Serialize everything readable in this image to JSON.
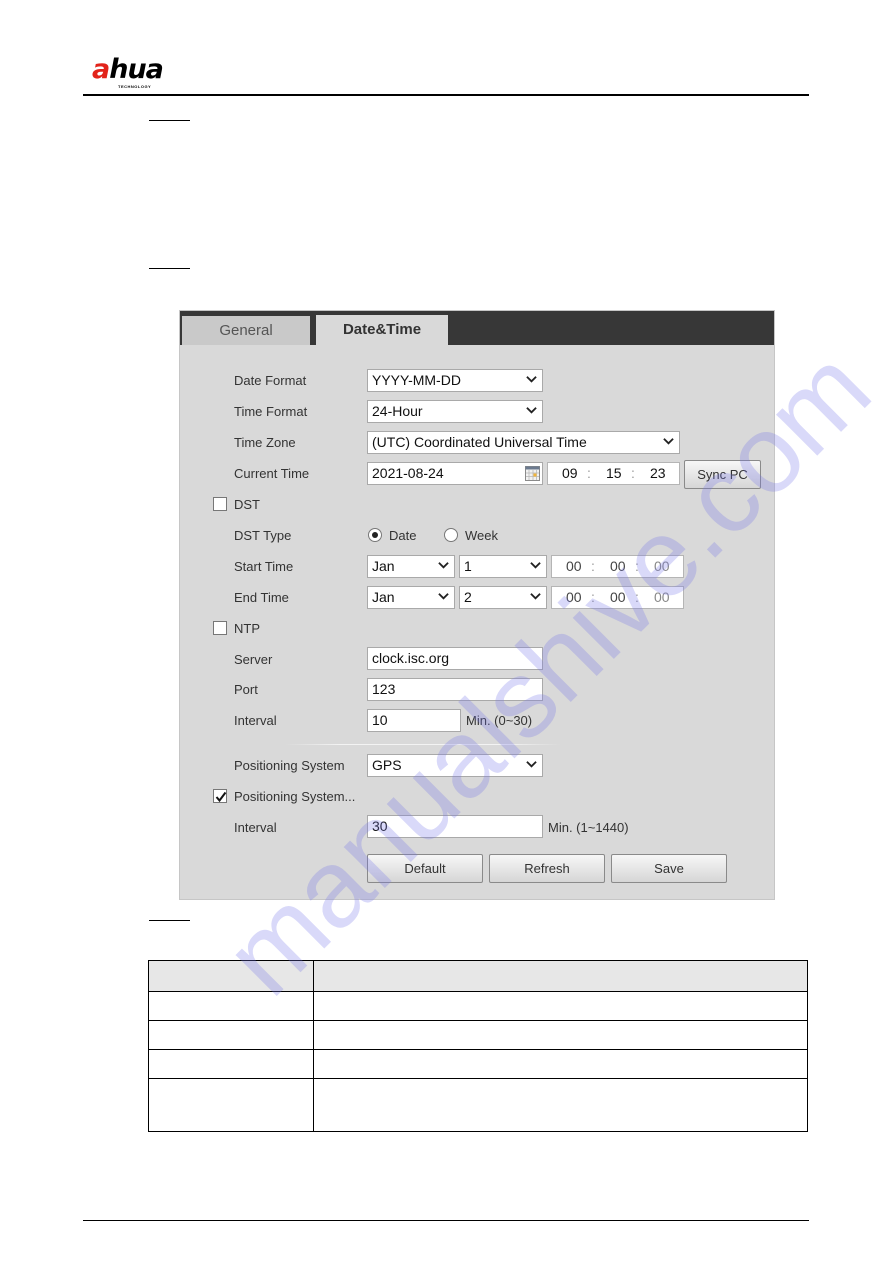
{
  "brand": {
    "name_prefix": "a",
    "name_rest": "hua",
    "tagline": "TECHNOLOGY",
    "accent_color": "#e2231a"
  },
  "panel": {
    "tabs": [
      {
        "label": "General",
        "active": false
      },
      {
        "label": "Date&Time",
        "active": true
      }
    ],
    "date_format": {
      "label": "Date Format",
      "value": "YYYY-MM-DD"
    },
    "time_format": {
      "label": "Time Format",
      "value": "24-Hour"
    },
    "time_zone": {
      "label": "Time Zone",
      "value": "(UTC) Coordinated Universal Time"
    },
    "current_time": {
      "label": "Current Time",
      "date": "2021-08-24",
      "hh": "09",
      "mm": "15",
      "ss": "23",
      "sync_button": "Sync PC"
    },
    "dst": {
      "label": "DST",
      "checked": false,
      "type_label": "DST Type",
      "type_options": [
        {
          "label": "Date",
          "selected": true
        },
        {
          "label": "Week",
          "selected": false
        }
      ],
      "start": {
        "label": "Start Time",
        "month": "Jan",
        "day": "1",
        "hh": "00",
        "mm": "00",
        "ss": "00"
      },
      "end": {
        "label": "End Time",
        "month": "Jan",
        "day": "2",
        "hh": "00",
        "mm": "00",
        "ss": "00"
      }
    },
    "ntp": {
      "label": "NTP",
      "checked": false,
      "server_label": "Server",
      "server": "clock.isc.org",
      "port_label": "Port",
      "port": "123",
      "interval_label": "Interval",
      "interval": "10",
      "interval_hint": "Min. (0~30)"
    },
    "positioning": {
      "label": "Positioning System",
      "value": "GPS",
      "sync_label": "Positioning System...",
      "sync_checked": true,
      "interval_label": "Interval",
      "interval": "30",
      "interval_hint": "Min. (1~1440)"
    },
    "buttons": {
      "default": "Default",
      "refresh": "Refresh",
      "save": "Save"
    },
    "time_separator": ":"
  },
  "table": {
    "rows": 4
  },
  "watermark": "manualshive.com"
}
